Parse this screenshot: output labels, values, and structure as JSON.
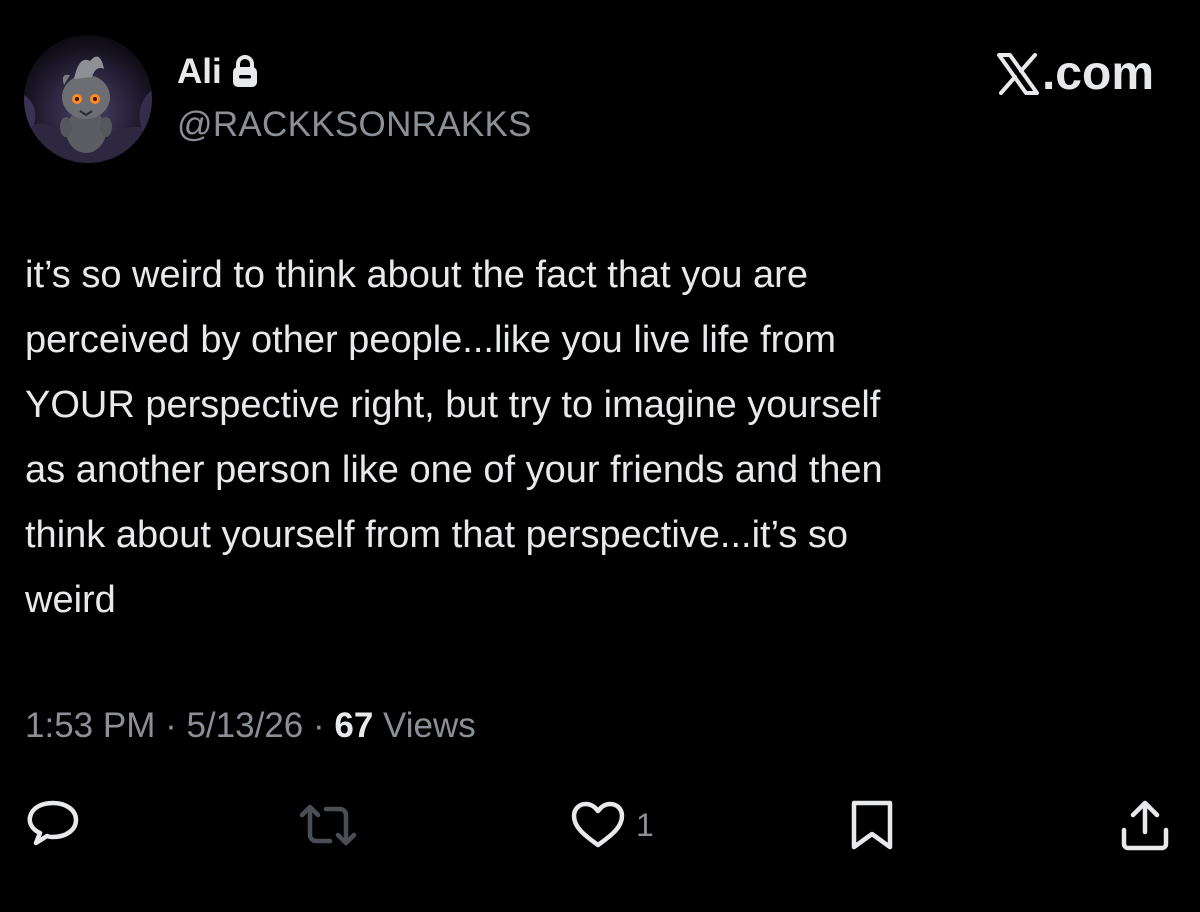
{
  "author": {
    "display_name": "Ali",
    "handle": "@RACKKSONRAKKS",
    "protected_icon": "lock-icon"
  },
  "brand": {
    "text": ".com",
    "icon": "x-logo-icon"
  },
  "tweet": {
    "text": "it’s so weird to think about the fact that you are\nperceived by other people...like you live life from\nYOUR perspective right, but try to imagine yourself\nas another person like one of your friends and then\nthink about yourself from that perspective...it’s so\nweird"
  },
  "meta": {
    "time": "1:53 PM",
    "separator": " · ",
    "date": "5/13/26",
    "views_count": "67",
    "views_label": " Views"
  },
  "actions": {
    "reply_icon": "reply-icon",
    "repost_icon": "repost-icon",
    "like_icon": "heart-icon",
    "like_count": "1",
    "bookmark_icon": "bookmark-icon",
    "share_icon": "share-icon"
  },
  "colors": {
    "background": "#000000",
    "primary_text": "#e7e9ea",
    "secondary_text": "#8b9096",
    "repost_icon_dim": "#4a4f55"
  }
}
